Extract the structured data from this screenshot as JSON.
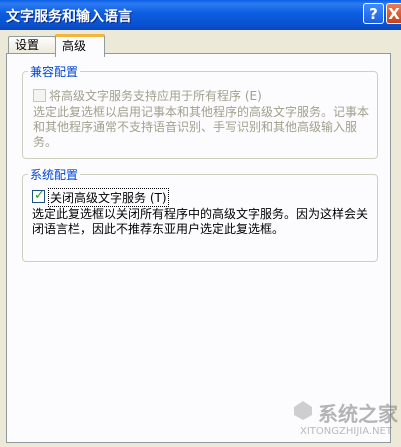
{
  "window": {
    "title": "文字服务和输入语言",
    "help_label": "?",
    "close_label": "X"
  },
  "tabs": [
    {
      "label": "设置"
    },
    {
      "label": "高级"
    }
  ],
  "compat_group": {
    "legend": "兼容配置",
    "checkbox_label": "将高级文字服务支持应用于所有程序 (E)",
    "checked": false,
    "enabled": false,
    "description": "选定此复选框以启用记事本和其他程序的高级文字服务。记事本和其他程序通常不支持语音识别、手写识别和其他高级输入服务。"
  },
  "system_group": {
    "legend": "系统配置",
    "checkbox_label": "关闭高级文字服务 (T)",
    "checked": true,
    "description": "选定此复选框以关闭所有程序中的高级文字服务。因为这样会关闭语言栏，因此不推荐东亚用户选定此复选框。"
  },
  "watermark": {
    "text": "系统之家",
    "url": "XITONGZHIJIA.NET"
  }
}
